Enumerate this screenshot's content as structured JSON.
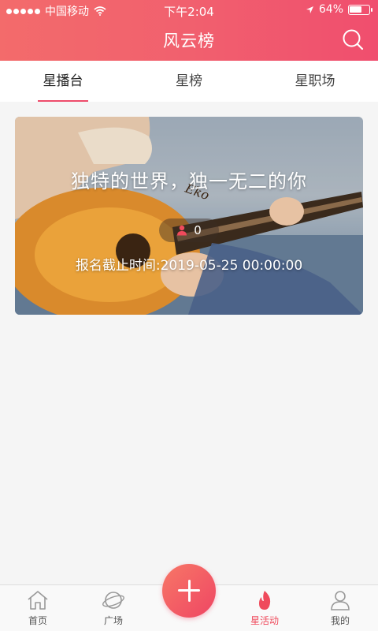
{
  "status_bar": {
    "carrier": "中国移动",
    "time": "下午2:04",
    "battery": "64%",
    "battery_level": 0.64
  },
  "header": {
    "title": "风云榜",
    "search_icon": "search-icon"
  },
  "tabs": [
    {
      "label": "星播台",
      "active": true
    },
    {
      "label": "星榜",
      "active": false
    },
    {
      "label": "星职场",
      "active": false
    }
  ],
  "card": {
    "title": "独特的世界，独一无二的你",
    "participant_count": "0",
    "deadline": "报名截止时间:2019-05-25 00:00:00",
    "guitar_text": "Eko"
  },
  "tab_bar": {
    "items": [
      {
        "label": "首页",
        "icon": "home-icon",
        "active": false
      },
      {
        "label": "广场",
        "icon": "planet-icon",
        "active": false
      },
      {
        "label": "星活动",
        "icon": "flame-icon",
        "active": true
      },
      {
        "label": "我的",
        "icon": "user-icon",
        "active": false
      }
    ],
    "fab_icon": "plus-icon"
  },
  "colors": {
    "accent": "#ef4a5c",
    "header_start": "#f36b6b",
    "header_end": "#f04e6e"
  }
}
